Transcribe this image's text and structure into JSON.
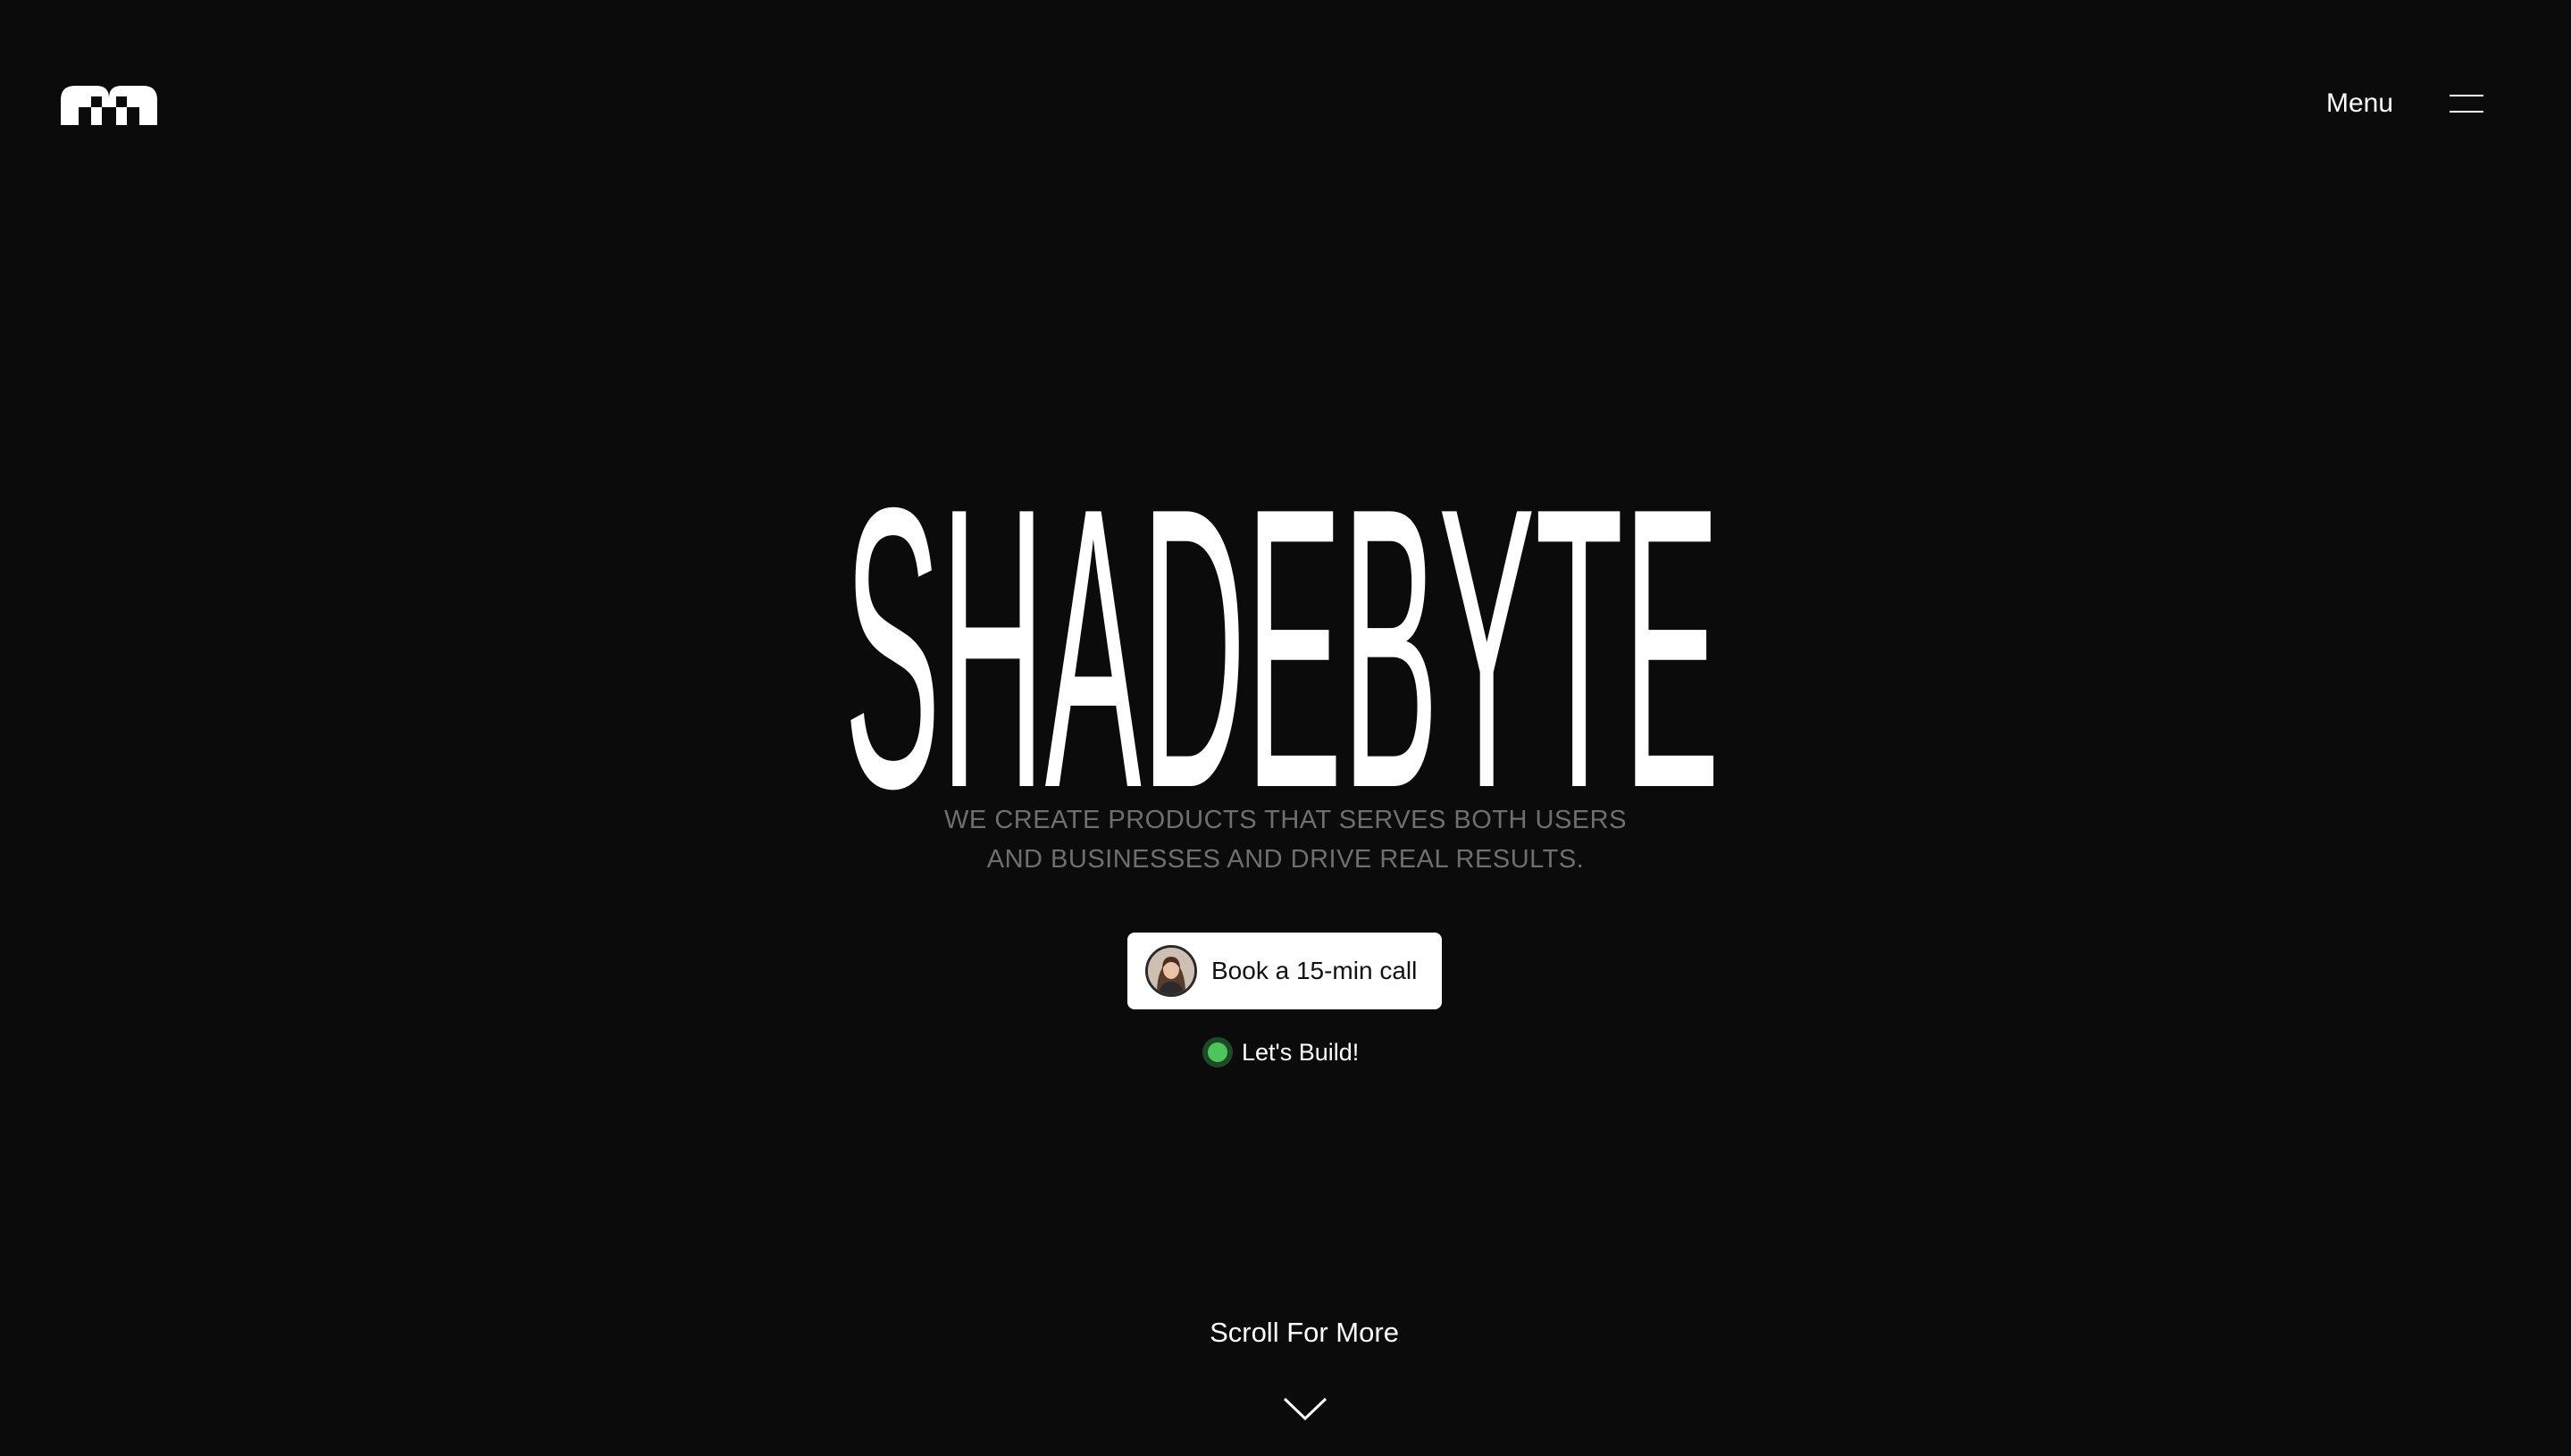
{
  "header": {
    "logo_icon": "brand-mark-icon",
    "trademark": "™",
    "menu_label": "Menu",
    "menu_icon": "hamburger-icon"
  },
  "hero": {
    "title": "SHADEBYTE",
    "tagline_line1": "WE CREATE PRODUCTS THAT SERVES BOTH USERS",
    "tagline_line2": "AND BUSINESSES AND DRIVE REAL RESULTS.",
    "cta_label": "Book a 15-min call",
    "cta_avatar_icon": "avatar-portrait",
    "status_label": "Let's Build!",
    "status_color": "#4fc35d"
  },
  "footer": {
    "scroll_label": "Scroll For More",
    "scroll_icon": "chevron-down-icon"
  },
  "colors": {
    "background": "#0b0b0b",
    "text": "#ffffff",
    "muted": "#6f6f6f",
    "button_bg": "#ffffff",
    "button_text": "#111111"
  }
}
